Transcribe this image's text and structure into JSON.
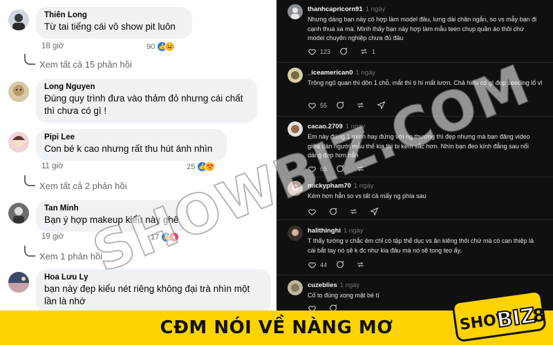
{
  "left_comments": [
    {
      "name": "Thiên Long",
      "text": "Từ tai tiếng cái vô show pit luôn",
      "time": "18 giờ",
      "reactions": "90",
      "replies": "Xem tất cả 15 phản hồi"
    },
    {
      "name": "Long Nguyen",
      "text": "Đúng quy trình đưa vào thảm đỏ nhưng cái chất thì chưa có gì !"
    },
    {
      "name": "Pipi Lee",
      "text": "Con bé k cao nhưng rất thu hút ánh nhìn",
      "time": "11 giờ",
      "reactions": "25",
      "replies": "Xem tất cả 2 phản hồi"
    },
    {
      "name": "Tan Minh",
      "text": "Bạn ý hợp makeup kiểu này ghê",
      "time": "19 giờ",
      "reactions": "17",
      "replies": "Xem 1 phản hồi"
    },
    {
      "name": "Hoa Lưu Ly",
      "text": "bạn này đẹp kiểu nét riêng không đại trà nhìn một lần là nhớ"
    }
  ],
  "right_posts": [
    {
      "user": "thanhcapricorn91",
      "ago": "1 ngày",
      "text": "Nhưng dáng bạn này có hợp làm model đâu, lưng dài chân ngắn, so vs mẫy bạn đi cạnh thua xa mà. Mình thấy bạn này hợp làm mẫu teen chụp quần áo thôi chứ model chuyên nghiệp chưa đủ đâu",
      "likes": "123",
      "replies": "",
      "reposts": "1"
    },
    {
      "user": "_iceamerican0",
      "ago": "1 ngày",
      "text": "Trông ngũ quan thì dồn 1 chỗ, mắt thì ti hí mất lươn. Chả hiểu có gì đẹp seeding lố vl",
      "likes": "55",
      "replies": "",
      "reposts": ""
    },
    {
      "user": "cacao.2709",
      "ago": "1 ngày",
      "text": "Em này đứng 1 mình hay đứng với ng thường thì đẹp nhưng mà bạn đăng video giữa dàn người mẫu thế kia thì bị kém sắc hơn. Nhìn bạn đeo kính đẳng sau nổi dáng đẹp hơn hẳn",
      "likes": "65",
      "replies": "",
      "reposts": ""
    },
    {
      "user": "mickypham70",
      "ago": "1 ngày",
      "text": "Kém hơn hẳn so vs tất cả mấy ng phía sau",
      "likes": "",
      "replies": "",
      "reposts": ""
    },
    {
      "user": "halithinghi",
      "ago": "1 ngày",
      "text": "T thấy tướng v chắc ẻm chỉ có tập thể dục vs ăn kiêng thôi chứ mà có can thiệp là cái bắt tay nó sẽ k đc như kia đâu mà nó sẽ tong teo ấy.",
      "likes": "44",
      "replies": "",
      "reposts": ""
    },
    {
      "user": "cuzeblies",
      "ago": "1 ngày",
      "text": "Cố to đùng xong mặt bé tí",
      "likes": "",
      "replies": "",
      "reposts": ""
    }
  ],
  "watermark": "SHOWBIZ.COM",
  "banner": {
    "title": "CĐM NÓI VỀ NÀNG MƠ",
    "logo_main": "SHOW",
    "logo_accent": "BIZ",
    "logo_suffix": "8"
  },
  "colors": {
    "banner": "#ffd300",
    "fb_link": "#1877f2",
    "threads_bg": "#101010"
  }
}
